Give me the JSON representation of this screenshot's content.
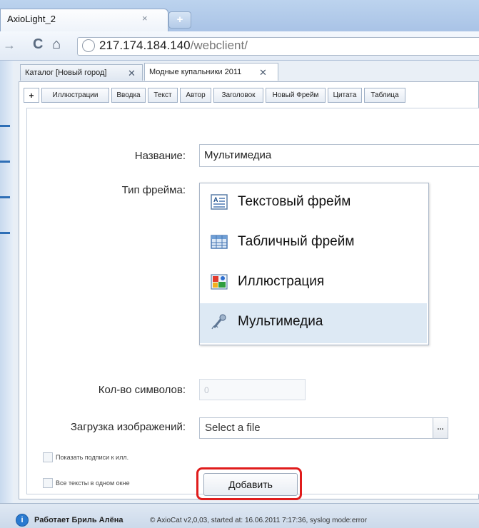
{
  "browser": {
    "tab_title": "AxioLight_2",
    "tab_close": "×",
    "new_tab": "+",
    "url_host": "217.174.184.140",
    "url_path": "/webclient/"
  },
  "app": {
    "doc_tabs": [
      {
        "label": "Каталог [Новый город]",
        "close": "✕"
      },
      {
        "label": "Модные купальники 2011",
        "close": "✕"
      }
    ],
    "frame_tabs": [
      "+",
      "Иллюстрации",
      "Вводка",
      "Текст",
      "Автор",
      "Заголовок",
      "Новый Фрейм",
      "Цитата",
      "Таблица"
    ],
    "form": {
      "name_label": "Название:",
      "name_value": "Мультимедиа",
      "frame_type_label": "Тип фрейма:",
      "frame_types": [
        {
          "label": "Текстовый фрейм",
          "icon": "text-frame-icon",
          "selected": false
        },
        {
          "label": "Табличный фрейм",
          "icon": "table-frame-icon",
          "selected": false
        },
        {
          "label": "Иллюстрация",
          "icon": "illustration-icon",
          "selected": false
        },
        {
          "label": "Мультимедиа",
          "icon": "multimedia-icon",
          "selected": true
        }
      ],
      "char_count_label": "Кол-во символов:",
      "char_count_value": "0",
      "image_upload_label": "Загрузка изображений:",
      "image_upload_placeholder": "Select a file",
      "browse_button": "...",
      "checkbox_captions": "Показать подписи к илл.",
      "checkbox_single_window": "Все тексты в одном окне",
      "add_button": "Добавить"
    }
  },
  "status_bar": {
    "user": "Работает Бриль Алёна",
    "info": "© AxioCat v2,0,03, started at: 16.06.2011 7:17:36, syslog mode:error"
  },
  "colors": {
    "highlight": "#e01c1c",
    "selected_item": "#dde9f4",
    "accent": "#2a7ad0"
  }
}
